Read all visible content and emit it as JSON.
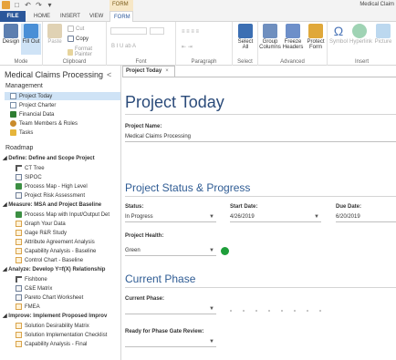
{
  "titlebar": {
    "title": "Medical Claim",
    "context_tab": "FORM"
  },
  "tabs": [
    "FILE",
    "HOME",
    "INSERT",
    "VIEW",
    "FORM"
  ],
  "ribbon": {
    "groups": [
      "Mode",
      "Clipboard",
      "Font",
      "Paragraph",
      "Select",
      "Advanced",
      "Insert"
    ],
    "buttons": {
      "design": "Design",
      "fill_out": "Fill Out",
      "paste": "Paste",
      "cut": "Cut",
      "copy": "Copy",
      "format_painter": "Format Painter",
      "select_all": "Select All",
      "group_columns": "Group Columns",
      "freeze_headers": "Freeze Headers",
      "protect_form": "Protect Form",
      "symbol": "Symbol",
      "hyperlink": "Hyperlink",
      "picture": "Picture"
    }
  },
  "sidebar": {
    "title": "Medical Claims Processing",
    "collapse": "<",
    "management": {
      "label": "Management",
      "items": [
        "Project Today",
        "Project Charter",
        "Financial Data",
        "Team Members & Roles",
        "Tasks"
      ]
    },
    "roadmap": {
      "label": "Roadmap",
      "phases": [
        {
          "title": "Define: Define and Scope Project",
          "items": [
            "CT Tree",
            "SIPOC",
            "Process Map - High Level",
            "Project Risk Assessment"
          ]
        },
        {
          "title": "Measure: MSA and Project Baseline",
          "items": [
            "Process Map with Input/Output Det",
            "Graph Your Data",
            "Gage R&R Study",
            "Attribute Agreement Analysis",
            "Capability Analysis - Baseline",
            "Control Chart - Baseline"
          ]
        },
        {
          "title": "Analyze: Develop Y=f(X) Relationship",
          "items": [
            "Fishbone",
            "C&E Matrix",
            "Pareto Chart Worksheet",
            "FMEA"
          ]
        },
        {
          "title": "Improve: Implement Proposed Improv",
          "items": [
            "Solution Desirability Matrix",
            "Solution Implementation Checklist",
            "Capability Analysis - Final"
          ]
        }
      ]
    }
  },
  "doc": {
    "tab_label": "Project Today",
    "tab_close": "×",
    "title": "Project Today",
    "project_name_label": "Project Name:",
    "project_name_value": "Medical Claims Processing",
    "status_section": "Project Status & Progress",
    "status_label": "Status:",
    "status_value": "In Progress",
    "start_label": "Start Date:",
    "start_value": "4/26/2019",
    "due_label": "Due Date:",
    "due_value": "6/20/2019",
    "health_label": "Project Health:",
    "health_value": "Green",
    "health_color": "#1e9e3a",
    "phase_section": "Current Phase",
    "current_phase_label": "Current Phase:",
    "current_phase_value": "",
    "gate_label": "Ready for Phase Gate Review:",
    "gate_value": ""
  },
  "colors": {
    "accent": "#2b579a",
    "heading": "#2f5c94",
    "context_tab": "#f7e7c6"
  }
}
